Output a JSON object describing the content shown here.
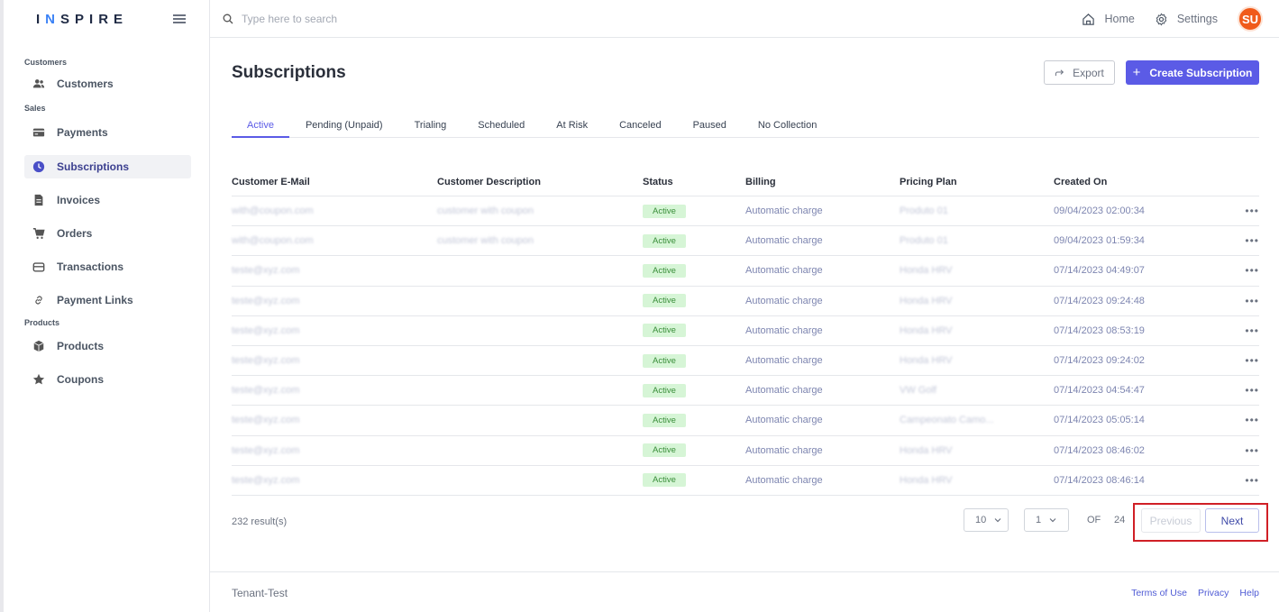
{
  "brand": {
    "logo_part1": "I",
    "logo_accent": "N",
    "logo_part2": "SPIRE"
  },
  "search": {
    "placeholder": "Type here to search"
  },
  "topbar": {
    "home_label": "Home",
    "settings_label": "Settings",
    "avatar_initials": "SU"
  },
  "sidebar": {
    "section_customers": "Customers",
    "section_sales": "Sales",
    "section_products": "Products",
    "items": {
      "customers": "Customers",
      "payments": "Payments",
      "subscriptions": "Subscriptions",
      "invoices": "Invoices",
      "orders": "Orders",
      "transactions": "Transactions",
      "payment_links": "Payment Links",
      "products": "Products",
      "coupons": "Coupons"
    }
  },
  "page": {
    "title": "Subscriptions",
    "export_label": "Export",
    "create_label": "Create Subscription"
  },
  "tabs": [
    "Active",
    "Pending (Unpaid)",
    "Trialing",
    "Scheduled",
    "At Risk",
    "Canceled",
    "Paused",
    "No Collection"
  ],
  "table": {
    "headers": [
      "Customer E-Mail",
      "Customer Description",
      "Status",
      "Billing",
      "Pricing Plan",
      "Created On"
    ],
    "rows": [
      {
        "email": "with@coupon.com",
        "description": "customer with coupon",
        "status": "Active",
        "billing": "Automatic charge",
        "plan": "Produto 01",
        "created": "09/04/2023 02:00:34"
      },
      {
        "email": "with@coupon.com",
        "description": "customer with coupon",
        "status": "Active",
        "billing": "Automatic charge",
        "plan": "Produto 01",
        "created": "09/04/2023 01:59:34"
      },
      {
        "email": "teste@xyz.com",
        "description": "",
        "status": "Active",
        "billing": "Automatic charge",
        "plan": "Honda HRV",
        "created": "07/14/2023 04:49:07"
      },
      {
        "email": "teste@xyz.com",
        "description": "",
        "status": "Active",
        "billing": "Automatic charge",
        "plan": "Honda HRV",
        "created": "07/14/2023 09:24:48"
      },
      {
        "email": "teste@xyz.com",
        "description": "",
        "status": "Active",
        "billing": "Automatic charge",
        "plan": "Honda HRV",
        "created": "07/14/2023 08:53:19"
      },
      {
        "email": "teste@xyz.com",
        "description": "",
        "status": "Active",
        "billing": "Automatic charge",
        "plan": "Honda HRV",
        "created": "07/14/2023 09:24:02"
      },
      {
        "email": "teste@xyz.com",
        "description": "",
        "status": "Active",
        "billing": "Automatic charge",
        "plan": "VW Golf",
        "created": "07/14/2023 04:54:47"
      },
      {
        "email": "teste@xyz.com",
        "description": "",
        "status": "Active",
        "billing": "Automatic charge",
        "plan": "Campeonato Camo...",
        "created": "07/14/2023 05:05:14"
      },
      {
        "email": "teste@xyz.com",
        "description": "",
        "status": "Active",
        "billing": "Automatic charge",
        "plan": "Honda HRV",
        "created": "07/14/2023 08:46:02"
      },
      {
        "email": "teste@xyz.com",
        "description": "",
        "status": "Active",
        "billing": "Automatic charge",
        "plan": "Honda HRV",
        "created": "07/14/2023 08:46:14"
      }
    ],
    "row_menu": "•••"
  },
  "pagination": {
    "results": "232 result(s)",
    "page_size": "10",
    "page": "1",
    "of_label": "OF",
    "total_pages": "24",
    "prev_label": "Previous",
    "next_label": "Next"
  },
  "footer": {
    "tenant": "Tenant-Test",
    "terms": "Terms of Use",
    "privacy": "Privacy",
    "help": "Help"
  },
  "colors": {
    "accent": "#5b5be6",
    "avatar": "#f05a1a",
    "status_bg": "#d6f5d6",
    "highlight": "#d01f26"
  }
}
